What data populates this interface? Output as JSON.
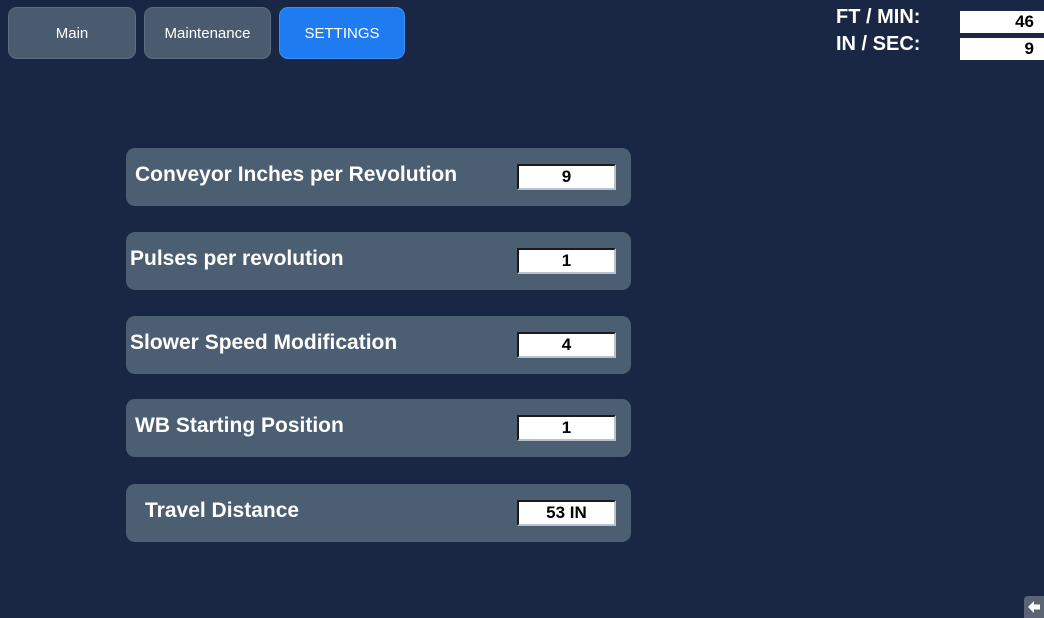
{
  "tabs": [
    {
      "label": "Main"
    },
    {
      "label": "Maintenance"
    },
    {
      "label": "SETTINGS"
    }
  ],
  "header": {
    "ft_min_label": "FT / MIN:",
    "ft_min_value": "46",
    "in_sec_label": "IN / SEC:",
    "in_sec_value": "9"
  },
  "settings": [
    {
      "label": "Conveyor Inches per Revolution",
      "value": "9"
    },
    {
      "label": "Pulses per revolution",
      "value": "1"
    },
    {
      "label": "Slower Speed Modification",
      "value": "4"
    },
    {
      "label": "WB Starting Position",
      "value": "1"
    },
    {
      "label": "Travel Distance",
      "value": "53 IN"
    }
  ],
  "colors": {
    "background": "#1a2744",
    "tab_inactive": "#4a5b70",
    "tab_active": "#1f7cf0",
    "row_panel": "#4c5e72"
  },
  "icons": {
    "back": "back-arrow-icon"
  }
}
